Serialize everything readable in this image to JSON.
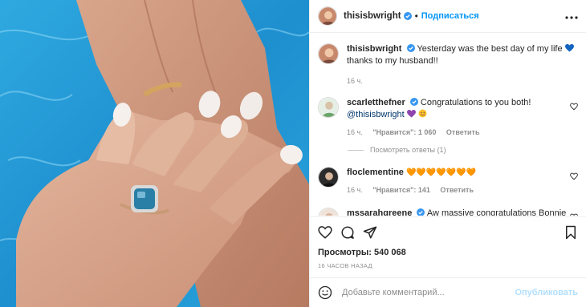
{
  "post": {
    "image_alt": "Hands with nail polish and an engagement ring over pool water"
  },
  "header": {
    "username": "thisisbwright",
    "dot": "•",
    "follow_label": "Подписаться",
    "more_icon": "more-horizontal-icon"
  },
  "caption": {
    "username": "thisisbwright",
    "text": "Yesterday was the best day of my life",
    "text_after": "thanks to my husband!!",
    "time": "16 ч."
  },
  "comments": [
    {
      "username": "scarletthefner",
      "text": "Congratulations to you both!",
      "mention": "@thisisbwright",
      "time": "16 ч.",
      "likes": "\"Нравится\": 1 060",
      "reply": "Ответить",
      "view_replies": "Посмотреть ответы (1)"
    },
    {
      "username": "floclementine",
      "text": "🧡🧡🧡🧡🧡🧡🧡",
      "time": "16 ч.",
      "likes": "\"Нравится\": 141",
      "reply": "Ответить"
    },
    {
      "username": "mssarahgreene",
      "text": "Aw massive congratulations Bonnie"
    }
  ],
  "stats": {
    "views": "Просмотры: 540 068",
    "ago": "16 ЧАСОВ НАЗАД"
  },
  "add_comment": {
    "placeholder": "Добавьте комментарий...",
    "publish_label": "Опубликовать"
  },
  "colors": {
    "accent": "#0095f6",
    "verified": "#3897f0",
    "heart_purple": "#8e44ad",
    "heart_orange": "#f57f17",
    "heart_blue": "#1565c0"
  }
}
